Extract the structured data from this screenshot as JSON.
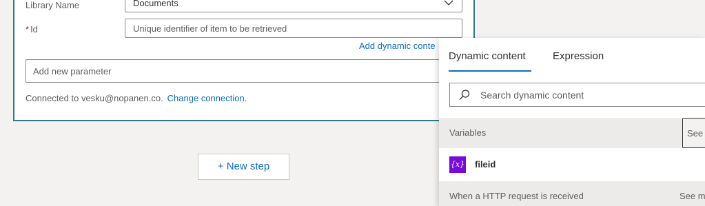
{
  "action_card": {
    "library_name_label": "Library Name",
    "library_name_value": "Documents",
    "id_required_marker": "*",
    "id_label": "Id",
    "id_placeholder": "Unique identifier of item to be retrieved",
    "add_dynamic_content_label": "Add dynamic conte",
    "add_parameter_placeholder": "Add new parameter",
    "connected_text": "Connected to vesku@nopanen.co.",
    "change_connection_label": "Change connection."
  },
  "new_step_label": "+ New step",
  "dynamic_panel": {
    "tabs": [
      {
        "label": "Dynamic content",
        "active": true
      },
      {
        "label": "Expression",
        "active": false
      }
    ],
    "search_placeholder": "Search dynamic content",
    "sections": [
      {
        "title": "Variables",
        "see_more_label": "See",
        "items": [
          {
            "icon": "variable-icon",
            "icon_text": "{x}",
            "label": "fileid"
          }
        ]
      },
      {
        "title": "When a HTTP request is received",
        "see_more_label": "See m"
      }
    ]
  },
  "colors": {
    "accent": "#0f6cbd",
    "card_border": "#2f7a85",
    "variable_icon_bg": "#770bd6",
    "required": "#a4262c"
  }
}
